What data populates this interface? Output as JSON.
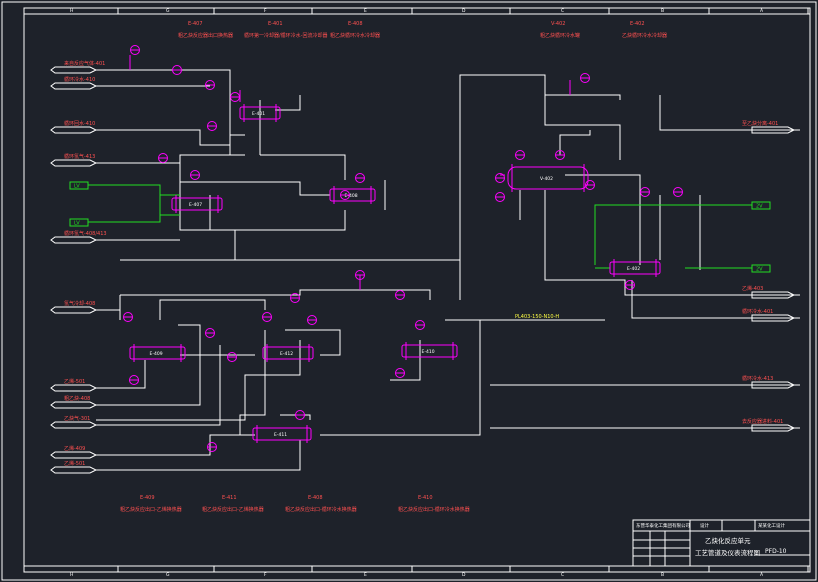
{
  "border_letters": [
    "H",
    "G",
    "F",
    "E",
    "D",
    "C",
    "B",
    "A"
  ],
  "header_labels": [
    {
      "id": "E-407",
      "desc": "粗乙炔反应器出口换热器"
    },
    {
      "id": "E-401",
      "desc": "循环第一冷却器/循环冷水-回流冷却器"
    },
    {
      "id": "E-408",
      "desc": "粗乙炔循环冷水冷却器"
    },
    {
      "id": "V-402",
      "desc": "粗乙炔循环冷水罐"
    },
    {
      "id": "E-402",
      "desc": "乙炔循环冷水冷却器"
    }
  ],
  "left_inlets": [
    "来自反应气体-401",
    "循环冷水-410",
    "循环回水-410",
    "循环氢气-413",
    "循环氢气-408/413",
    "氢气冷却-408",
    "乙烯-501",
    "粗乙炔-408",
    "乙炔气-301",
    "乙烯-409",
    "乙烯-501"
  ],
  "right_outlets": [
    "至乙炔分离-401",
    "乙烯-403",
    "循环冷水-401",
    "循环冷水-413",
    "去反应器进料-401"
  ],
  "equipment": [
    "E-401",
    "E-407",
    "E-408",
    "V-402",
    "E-402",
    "E-409",
    "E-412",
    "E-410",
    "E-411"
  ],
  "green_tags": [
    "LV",
    "LV",
    "2V",
    "2V"
  ],
  "line_label": "PL403-150-N10-H",
  "footer_labels": [
    {
      "id": "E-409",
      "desc": "粗乙炔反应出口-乙烯换热器"
    },
    {
      "id": "E-411",
      "desc": "粗乙炔反应出口-乙烯换热器"
    },
    {
      "id": "E-408",
      "desc": "粗乙炔反应出口-循环冷水换热器"
    },
    {
      "id": "E-410",
      "desc": "粗乙炔反应出口-循环冷水换热器"
    }
  ],
  "title_block": {
    "org": "东营华泰化工集团有限公司",
    "project": "某某化工设计",
    "title_line1": "乙炔化反应单元",
    "title_line2": "工艺管道及仪表流程图",
    "drawing_no": "PFD-10",
    "stage": "设计"
  }
}
